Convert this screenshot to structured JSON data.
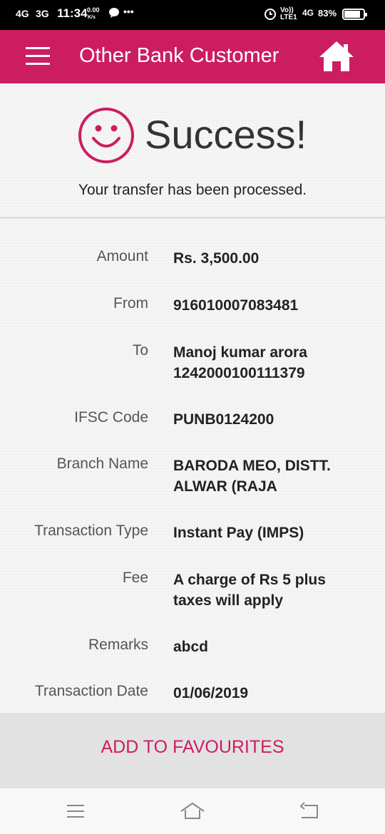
{
  "status_bar": {
    "network1": "4G",
    "network2": "3G",
    "time": "11:34",
    "speed": "0.00",
    "speed_unit": "K/s",
    "dots": "•••",
    "volte": "Vo)) LTE1",
    "network3": "4G",
    "battery": "83%",
    "battery_level": 0.83
  },
  "header": {
    "title": "Other Bank Customer",
    "menu_icon": "hamburger-menu-icon",
    "home_icon": "home-icon"
  },
  "result": {
    "icon": "smiley-face-icon",
    "title": "Success!",
    "message": "Your transfer has been processed."
  },
  "details": [
    {
      "label": "Amount",
      "value": "Rs. 3,500.00"
    },
    {
      "label": "From",
      "value": "916010007083481"
    },
    {
      "label": "To",
      "value": "Manoj kumar arora 1242000100111379"
    },
    {
      "label": "IFSC Code",
      "value": "PUNB0124200"
    },
    {
      "label": "Branch Name",
      "value": "BARODA MEO, DISTT. ALWAR (RAJA"
    },
    {
      "label": "Transaction Type",
      "value": "Instant Pay (IMPS)"
    },
    {
      "label": "Fee",
      "value": "A charge of Rs 5 plus taxes will apply"
    },
    {
      "label": "Remarks",
      "value": "abcd"
    },
    {
      "label": "Transaction Date",
      "value": "01/06/2019"
    }
  ],
  "actions": {
    "add_favourites": "ADD TO FAVOURITES"
  },
  "colors": {
    "brand": "#cc1d61",
    "status_bar": "#000000"
  },
  "nav_bar": {
    "recents_icon": "recents-icon",
    "home_icon": "home-outline-icon",
    "back_icon": "back-icon"
  }
}
